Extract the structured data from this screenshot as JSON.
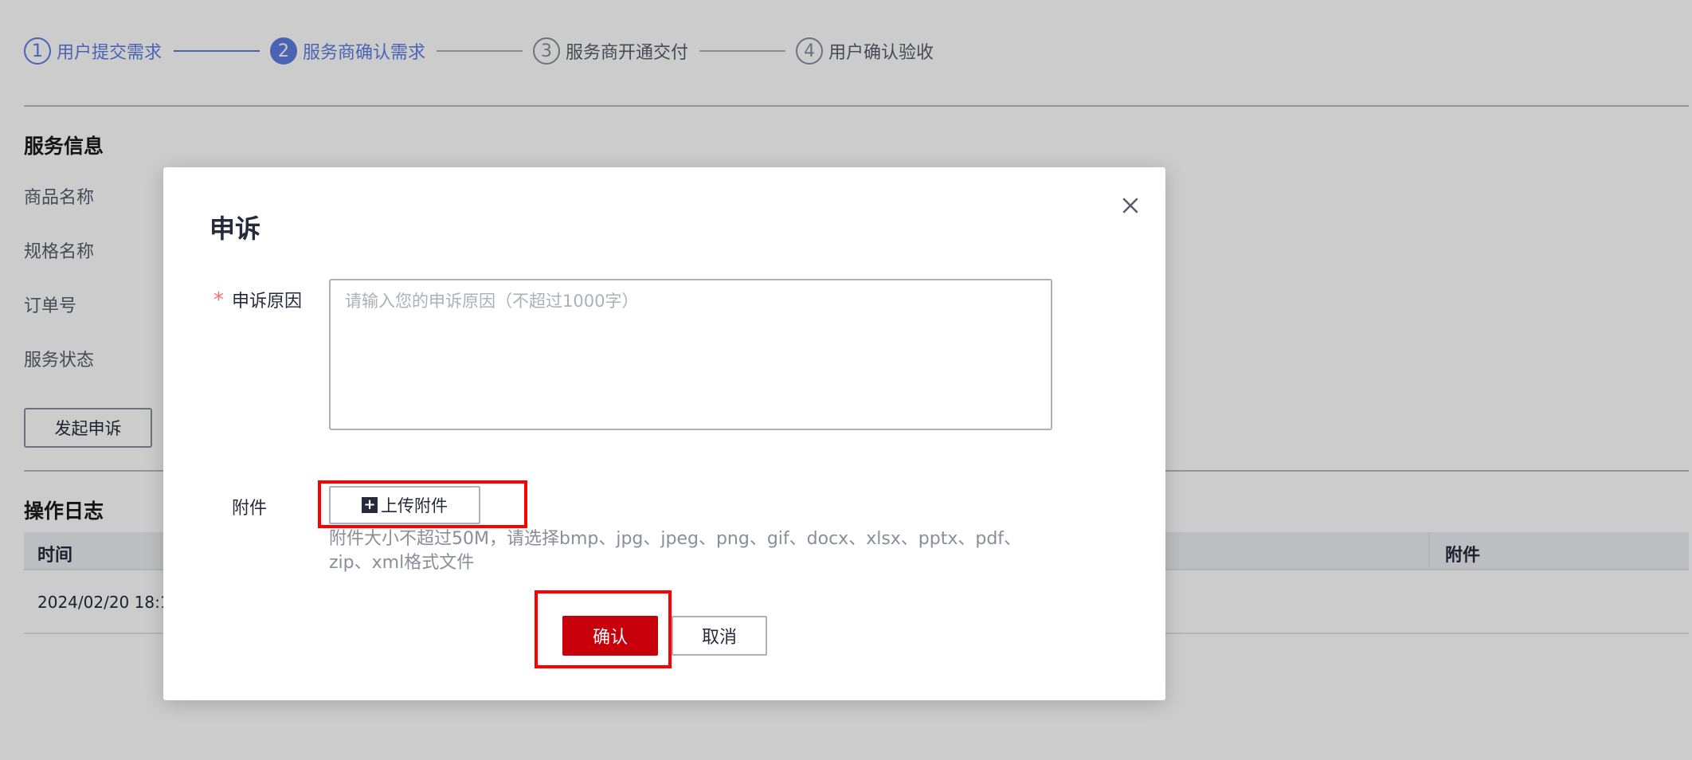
{
  "steps": [
    {
      "number": "1",
      "label": "用户提交需求"
    },
    {
      "number": "2",
      "label": "服务商确认需求"
    },
    {
      "number": "3",
      "label": "服务商开通交付"
    },
    {
      "number": "4",
      "label": "用户确认验收"
    }
  ],
  "service_info": {
    "title": "服务信息",
    "fields": [
      "商品名称",
      "规格名称",
      "订单号",
      "服务状态"
    ],
    "appeal_button": "发起申诉"
  },
  "operation_log": {
    "title": "操作日志",
    "columns": [
      "时间",
      "附件"
    ],
    "rows": [
      {
        "time": "2024/02/20 18:1"
      }
    ]
  },
  "modal": {
    "title": "申诉",
    "reason_label": "申诉原因",
    "required_mark": "*",
    "reason_placeholder": "请输入您的申诉原因（不超过1000字）",
    "reason_value": "",
    "attachment_label": "附件",
    "upload_button": "上传附件",
    "attachment_hint": "附件大小不超过50M，请选择bmp、jpg、jpeg、png、gif、docx、xlsx、pptx、pdf、zip、xml格式文件",
    "confirm_button": "确认",
    "cancel_button": "取消"
  },
  "colors": {
    "primary": "#5e7ce0",
    "danger": "#c7000b",
    "highlight": "#ff0000",
    "mask": "rgba(0,0,0,0.2)"
  },
  "icons": {
    "close": "close-icon",
    "upload": "plus-square-icon"
  }
}
